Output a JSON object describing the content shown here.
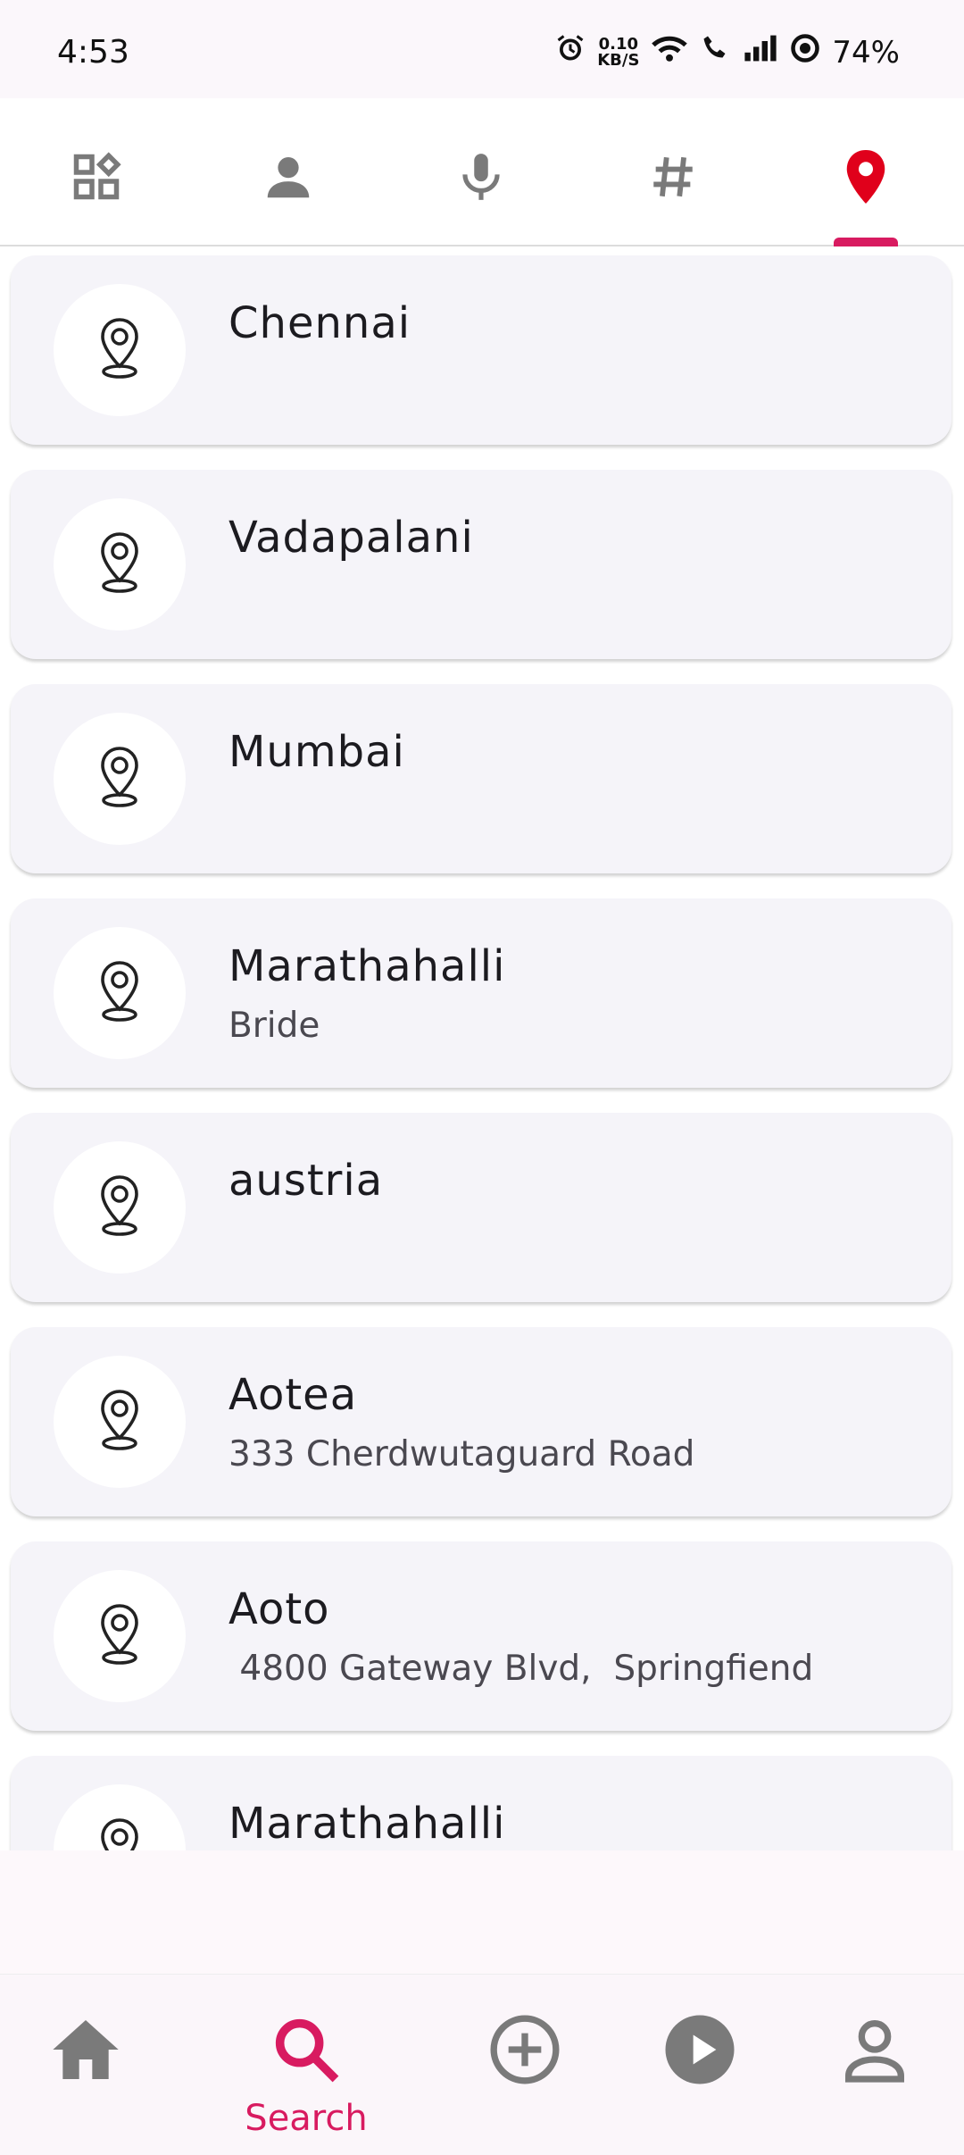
{
  "status": {
    "time": "4:53",
    "speed_value": "0.10",
    "speed_unit": "KB/S",
    "battery": "74%"
  },
  "tabs": [
    {
      "icon": "widgets-icon",
      "active": false
    },
    {
      "icon": "person-icon",
      "active": false
    },
    {
      "icon": "mic-icon",
      "active": false
    },
    {
      "icon": "hashtag-icon",
      "active": false
    },
    {
      "icon": "location-pin-icon",
      "active": true
    }
  ],
  "locations": [
    {
      "title": "Chennai",
      "subtitle": ""
    },
    {
      "title": "Vadapalani",
      "subtitle": ""
    },
    {
      "title": "Mumbai",
      "subtitle": ""
    },
    {
      "title": "Marathahalli",
      "subtitle": "Bride"
    },
    {
      "title": "austria",
      "subtitle": ""
    },
    {
      "title": "Aotea",
      "subtitle": "333 Cherdwutaguard Road"
    },
    {
      "title": "Aoto",
      "subtitle": " 4800 Gateway Blvd,  Springfiend"
    },
    {
      "title": "Marathahalli",
      "subtitle": ""
    }
  ],
  "bottom_nav": {
    "search_label": "Search"
  },
  "colors": {
    "accent": "#d81b60",
    "pin_active": "#e0001b",
    "icon_grey": "#757575"
  }
}
